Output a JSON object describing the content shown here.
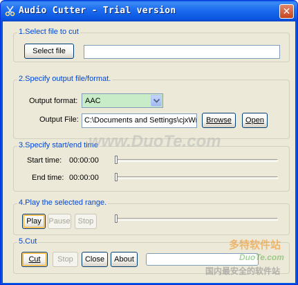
{
  "window": {
    "title": "Audio Cutter  - Trial version",
    "close_glyph": "✕"
  },
  "select_file": {
    "group_label": "1.Select file to cut",
    "button_label": "Select file",
    "file_path": ""
  },
  "output": {
    "group_label": "2.Specify output file/format.",
    "format_label": "Output format:",
    "format_value": "AAC",
    "file_label": "Output File:",
    "file_value": "C:\\Documents and Settings\\cjxWr",
    "browse_label": "Browse",
    "open_label": "Open"
  },
  "range": {
    "group_label": "3.Specify start/end time",
    "start_label": "Start time:",
    "start_value": "00:00:00",
    "end_label": "End time:",
    "end_value": "00:00:00",
    "start_position": 0,
    "end_position": 0
  },
  "playback": {
    "group_label": "4.Play the selected range.",
    "play_label": "Play",
    "pause_label": "Pause",
    "stop_label": "Stop",
    "position": 0
  },
  "cut": {
    "group_label": "5.Cut",
    "cut_label": "Cut",
    "stop_label": "Stop",
    "close_label": "Close",
    "about_label": "About",
    "progress": 0
  },
  "watermarks": {
    "site": "www.DuoTe.com",
    "brand_cn": "多特软件站",
    "brand_en": "DuoTe.com",
    "slogan_cn": "国内最安全的软件站"
  },
  "colors": {
    "title_bar": "#0a55e0",
    "group_label": "#0046d5",
    "client_bg": "#ece9d8",
    "combo_bg": "#c7ecc7"
  }
}
